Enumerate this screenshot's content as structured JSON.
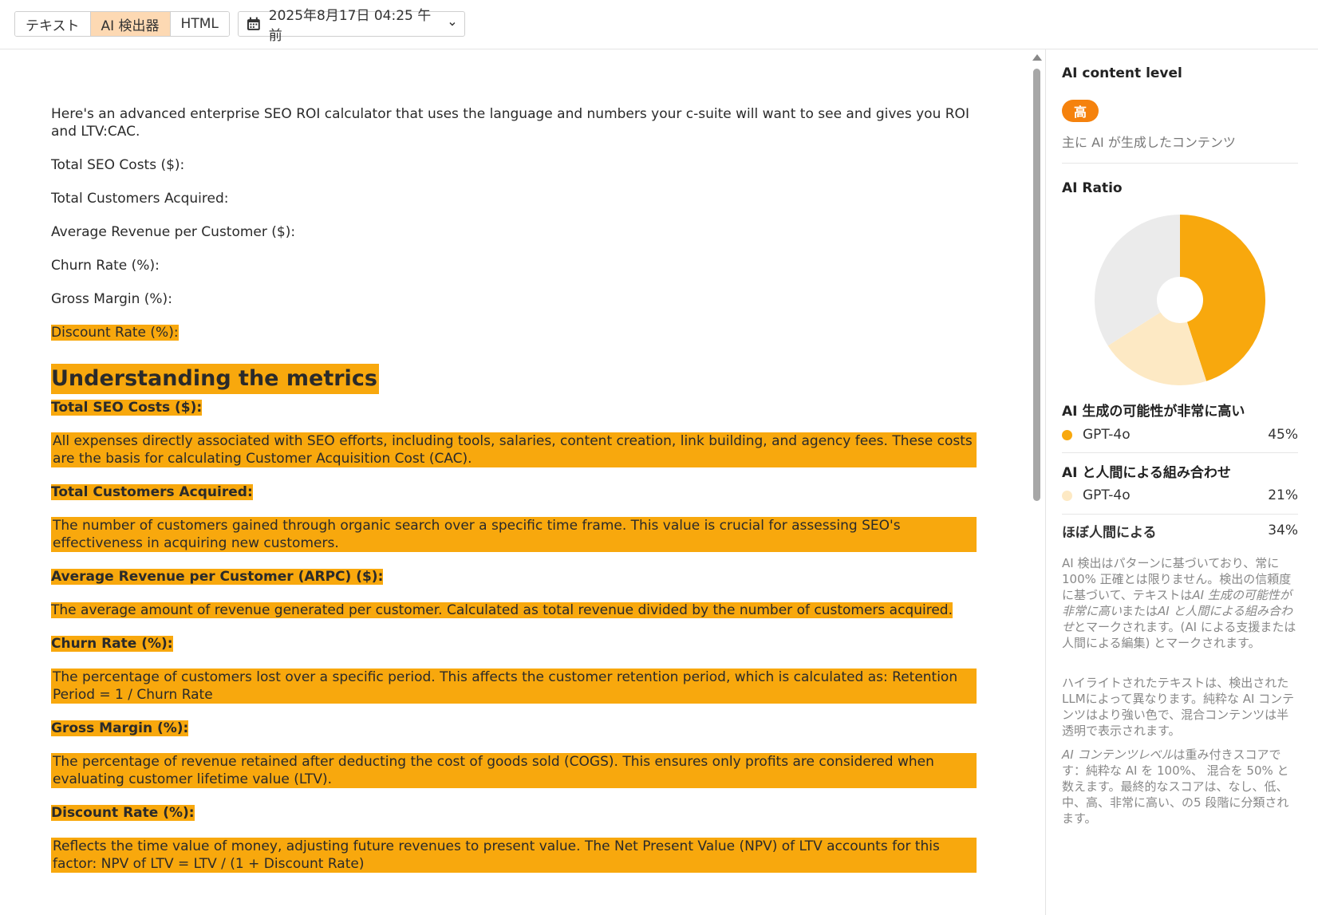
{
  "toolbar": {
    "tabs": [
      {
        "label": "テキスト",
        "active": false
      },
      {
        "label": "AI 検出器",
        "active": true
      },
      {
        "label": "HTML",
        "active": false
      }
    ],
    "date_label": "2025年8月17日 04:25 午前",
    "colors": {
      "active_tab": "#fdd9b3"
    }
  },
  "document": {
    "intro": "Here's an advanced enterprise SEO ROI calculator that uses the language and numbers your c-suite will want to see and gives you ROI and LTV:CAC.",
    "inputs": [
      "Total SEO Costs ($):",
      "Total Customers Acquired:",
      "Average Revenue per Customer ($):",
      "Churn Rate (%):",
      "Gross Margin (%):"
    ],
    "discount_input": "Discount Rate (%):",
    "heading": "Understanding the metrics",
    "metrics": [
      {
        "label": "Total SEO Costs ($):",
        "text": "All expenses directly associated with SEO efforts, including tools, salaries, content creation, link building, and agency fees. These costs are the basis for calculating Customer Acquisition Cost (CAC)."
      },
      {
        "label": "Total Customers Acquired:",
        "text": "The number of customers gained through organic search over a specific time frame. This value is crucial for assessing SEO's effectiveness in acquiring new customers."
      },
      {
        "label": "Average Revenue per Customer (ARPC) ($):",
        "text": "The average amount of revenue generated per customer. Calculated as total revenue divided by the number of customers acquired."
      },
      {
        "label": "Churn Rate (%):",
        "text": "The percentage of customers lost over a specific period. This affects the customer retention period, which is calculated as: Retention Period = 1 / Churn Rate"
      },
      {
        "label": "Gross Margin (%):",
        "text": "The percentage of revenue retained after deducting the cost of goods sold (COGS). This ensures only profits are considered when evaluating customer lifetime value (LTV)."
      },
      {
        "label": "Discount Rate (%):",
        "text": "Reflects the time value of money, adjusting future revenues to present value. The Net Present Value (NPV) of LTV accounts for this factor: NPV of LTV = LTV / (1 + Discount Rate)"
      }
    ],
    "colors": {
      "highlight": "#f8a80d"
    }
  },
  "panel": {
    "content_level_title": "AI content level",
    "level_badge": "高",
    "level_desc": "主に AI が生成したコンテンツ",
    "ratio_title": "AI Ratio",
    "chart_data": {
      "type": "pie",
      "categories": [
        "AI 生成の可能性が非常に高い",
        "AI と人間による組み合わせ",
        "ほぼ人間による"
      ],
      "values": [
        45,
        21,
        34
      ],
      "colors": [
        "#f8a80d",
        "#fde9c4",
        "#ebebeb"
      ]
    },
    "groups": [
      {
        "title": "AI 生成の可能性が非常に高い",
        "model": "GPT-4o",
        "pct": "45%"
      },
      {
        "title": "AI と人間による組み合わせ",
        "model": "GPT-4o",
        "pct": "21%"
      }
    ],
    "human": {
      "title": "ほぼ人間による",
      "pct": "34%"
    },
    "notes": {
      "n1a": "AI 検出はパターンに基づいており、常に 100% 正確とは限りません。検出の信頼度に基づいて、テキストは",
      "n1b": "AI 生成の可能性が非常に高い",
      "n1c": "または",
      "n1d": "AI と人間による組み合わせ",
      "n1e": "とマークされます。(AI による支援または人間による編集) とマークされます。",
      "n2": "ハイライトされたテキストは、検出されたLLMによって異なります。純粋な AI コンテンツはより強い色で、混合コンテンツは半透明で表示されます。",
      "n3a": "AI コンテンツレベル",
      "n3b": "は重み付きスコアです：純粋な AI を 100%、 混合を 50% と数えます。最終的なスコアは、なし、低、中、高、非常に高い、の5 段階に分類されます。"
    }
  }
}
